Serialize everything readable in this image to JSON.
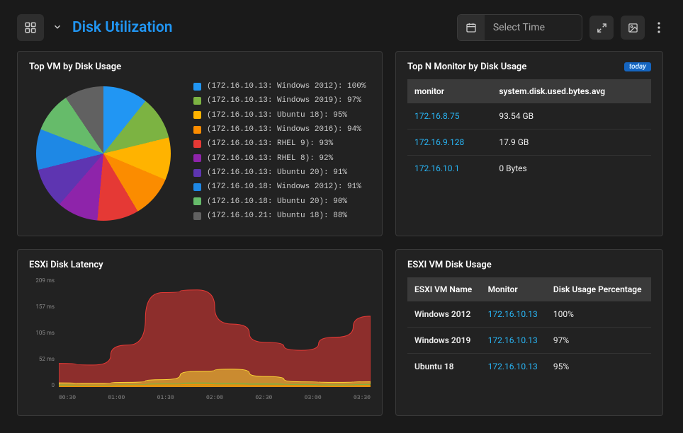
{
  "header": {
    "title": "Disk Utilization",
    "time_placeholder": "Select Time"
  },
  "panels": {
    "top_vm": {
      "title": "Top VM by Disk Usage"
    },
    "top_monitor": {
      "title": "Top N Monitor by Disk Usage",
      "badge": "today",
      "columns": {
        "c1": "monitor",
        "c2": "system.disk.used.bytes.avg"
      },
      "rows": [
        {
          "monitor": "172.16.8.75",
          "value": "93.54 GB"
        },
        {
          "monitor": "172.16.9.128",
          "value": "17.9 GB"
        },
        {
          "monitor": "172.16.10.1",
          "value": "0 Bytes"
        }
      ]
    },
    "latency": {
      "title": "ESXi Disk Latency"
    },
    "vm_usage": {
      "title": "ESXI VM Disk Usage",
      "columns": {
        "c1": "ESXI VM Name",
        "c2": "Monitor",
        "c3": "Disk Usage Percentage"
      },
      "rows": [
        {
          "name": "Windows 2012",
          "monitor": "172.16.10.13",
          "pct": "100%"
        },
        {
          "name": "Windows 2019",
          "monitor": "172.16.10.13",
          "pct": "97%"
        },
        {
          "name": "Ubuntu 18",
          "monitor": "172.16.10.13",
          "pct": "95%"
        }
      ]
    }
  },
  "chart_data": [
    {
      "type": "pie",
      "title": "Top VM by Disk Usage",
      "series": [
        {
          "name": "(172.16.10.13: Windows 2012): 100%",
          "value": 100,
          "color": "#2196f3"
        },
        {
          "name": "(172.16.10.13: Windows 2019): 97%",
          "value": 97,
          "color": "#7cb342"
        },
        {
          "name": "(172.16.10.13: Ubuntu 18): 95%",
          "value": 95,
          "color": "#ffb300"
        },
        {
          "name": "(172.16.10.13: Windows 2016): 94%",
          "value": 94,
          "color": "#fb8c00"
        },
        {
          "name": "(172.16.10.13: RHEL 9): 93%",
          "value": 93,
          "color": "#e53935"
        },
        {
          "name": "(172.16.10.13: RHEL 8): 92%",
          "value": 92,
          "color": "#8e24aa"
        },
        {
          "name": "(172.16.10.13: Ubuntu 20): 91%",
          "value": 91,
          "color": "#5e35b1"
        },
        {
          "name": "(172.16.10.18: Windows 2012): 91%",
          "value": 91,
          "color": "#1e88e5"
        },
        {
          "name": "(172.16.10.18: Ubuntu 20): 90%",
          "value": 90,
          "color": "#66bb6a"
        },
        {
          "name": "(172.16.10.21: Ubuntu 18): 88%",
          "value": 88,
          "color": "#616161"
        }
      ]
    },
    {
      "type": "area",
      "title": "ESXi Disk Latency",
      "ylabel": "ms",
      "ylim": [
        0,
        209
      ],
      "y_ticks": [
        "209 ms",
        "157 ms",
        "105 ms",
        "52 ms",
        "0"
      ],
      "x_ticks": [
        "00:30",
        "01:00",
        "01:30",
        "02:00",
        "02:30",
        "03:00",
        "03:30"
      ],
      "series": [
        {
          "name": "red",
          "color": "#e53935",
          "values": [
            45,
            42,
            80,
            180,
            185,
            120,
            85,
            70,
            95,
            135
          ]
        },
        {
          "name": "yellow",
          "color": "#fdd835",
          "values": [
            8,
            7,
            9,
            14,
            30,
            34,
            20,
            10,
            9,
            10
          ]
        },
        {
          "name": "green",
          "color": "#7cb342",
          "values": [
            4,
            3,
            4,
            6,
            8,
            7,
            6,
            5,
            4,
            5
          ]
        },
        {
          "name": "orange",
          "color": "#fb8c00",
          "values": [
            2,
            2,
            3,
            4,
            5,
            4,
            3,
            3,
            2,
            3
          ]
        }
      ]
    }
  ]
}
